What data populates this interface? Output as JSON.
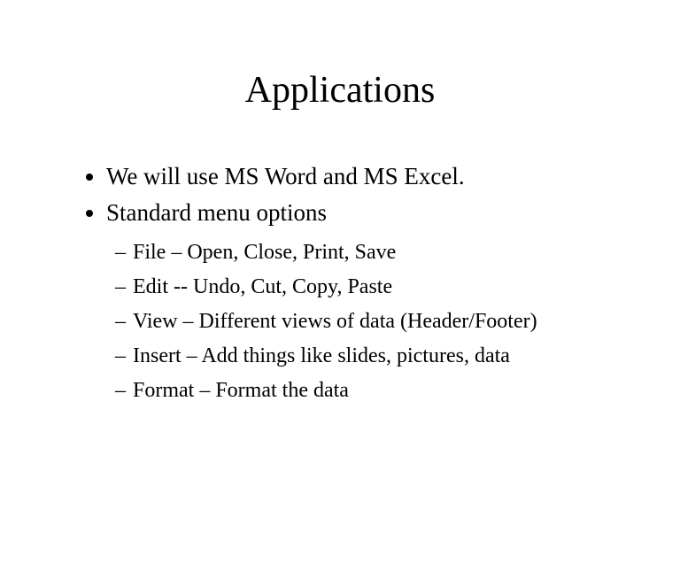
{
  "title": "Applications",
  "bullets": {
    "b1": "We will use MS Word and MS Excel.",
    "b2": "Standard menu options",
    "sub": {
      "s1": "File – Open,  Close, Print, Save",
      "s2": "Edit  -- Undo, Cut, Copy, Paste",
      "s3": "View – Different views of data (Header/Footer)",
      "s4": "Insert – Add things like slides, pictures, data",
      "s5": "Format – Format the data"
    }
  }
}
